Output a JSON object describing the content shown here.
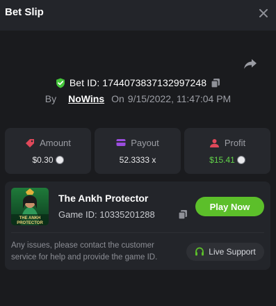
{
  "header": {
    "title": "Bet Slip"
  },
  "bet": {
    "id_label": "Bet ID: 174407383713299724­8",
    "by_label": "By",
    "user": "NoWins",
    "on_label": "On",
    "datetime": "9/15/2022, 11:47:04 PM"
  },
  "stats": [
    {
      "label": "Amount",
      "value": "$0.30",
      "icon": "tag-icon",
      "color": "#e0485a"
    },
    {
      "label": "Payout",
      "value": "52.3333 x",
      "icon": "wallet-icon",
      "color": "#9b4dde"
    },
    {
      "label": "Profit",
      "value": "$15.41",
      "icon": "profit-icon",
      "color": "#e0485a",
      "value_color": "#62d24a"
    }
  ],
  "game": {
    "title": "The Ankh Protector",
    "id_label": "Game ID: 10335201288",
    "play_label": "Play Now",
    "thumb_caption": "THE ANKH PROTECTOR"
  },
  "support": {
    "issue_text": "Any issues, please contact the customer service for help and provide the game ID.",
    "button_label": "Live Support"
  },
  "colors": {
    "accent_green": "#5cbf2a",
    "shield_green": "#44c43a"
  }
}
